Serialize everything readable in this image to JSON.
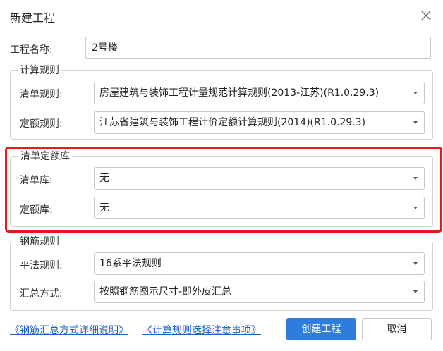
{
  "dialog": {
    "title": "新建工程",
    "close_icon": "close-icon"
  },
  "project_name": {
    "label": "工程名称:",
    "value": "2号楼"
  },
  "calc_rules": {
    "title": "计算规则",
    "bill_rule_label": "清单规则:",
    "bill_rule_value": "房屋建筑与装饰工程计量规范计算规则(2013-江苏)(R1.0.29.3)",
    "quota_rule_label": "定额规则:",
    "quota_rule_value": "江苏省建筑与装饰工程计价定额计算规则(2014)(R1.0.29.3)"
  },
  "bill_quota_lib": {
    "title": "清单定额库",
    "bill_lib_label": "清单库:",
    "bill_lib_value": "无",
    "quota_lib_label": "定额库:",
    "quota_lib_value": "无",
    "highlight_color": "#e8181e"
  },
  "rebar_rules": {
    "title": "钢筋规则",
    "flat_rule_label": "平法规则:",
    "flat_rule_value": "16系平法规则",
    "summary_label": "汇总方式:",
    "summary_value": "按照钢筋图示尺寸-即外皮汇总"
  },
  "footer": {
    "link_rebar": "《钢筋汇总方式详细说明》",
    "link_calc": "《计算规则选择注意事项》",
    "create_button": "创建工程",
    "cancel_button": "取消",
    "primary_color": "#2d7ddd",
    "link_color": "#1a62c8"
  }
}
